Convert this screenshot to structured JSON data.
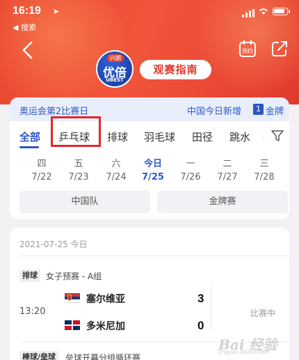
{
  "status_bar": {
    "time": "16:19",
    "back_app": "◀ 搜索"
  },
  "header": {
    "logo_top": "兴朗",
    "logo_main": "优倍",
    "logo_sub": "UBEST",
    "guide_label": "观赛指南"
  },
  "banner": {
    "title": "奥运会第2比赛日",
    "today_added": "中国今日新增",
    "gold_count": "1",
    "gold_label": "金牌"
  },
  "sport_tabs": [
    "全部",
    "乒乓球",
    "排球",
    "羽毛球",
    "田径",
    "跳水",
    "…"
  ],
  "days": [
    {
      "weekday": "四",
      "date": "7/22"
    },
    {
      "weekday": "五",
      "date": "7/23"
    },
    {
      "weekday": "六",
      "date": "7/24"
    },
    {
      "weekday": "今日",
      "date": "7/25"
    },
    {
      "weekday": "一",
      "date": "7/26"
    },
    {
      "weekday": "二",
      "date": "7/27"
    },
    {
      "weekday": "三",
      "date": "7/28"
    }
  ],
  "filters": {
    "team": "中国队",
    "medal": "金牌赛"
  },
  "schedule": {
    "date": "2021-07-25  今日",
    "match": {
      "sport": "排球",
      "group": "女子预赛 - A组",
      "time": "13:20",
      "team1": "塞尔维亚",
      "team2": "多米尼加",
      "score1": "3",
      "score2": "0",
      "status": "比赛中"
    },
    "next": {
      "sport": "棒球/垒球",
      "title": "垒球开幕分组循环赛"
    }
  },
  "watermark": {
    "main": "Bai 经验",
    "sub": "jingyan.baidu.com"
  },
  "colors": {
    "brand_red": "#e8452f",
    "accent_blue": "#2f55c8",
    "highlight_red": "#e3262d"
  }
}
